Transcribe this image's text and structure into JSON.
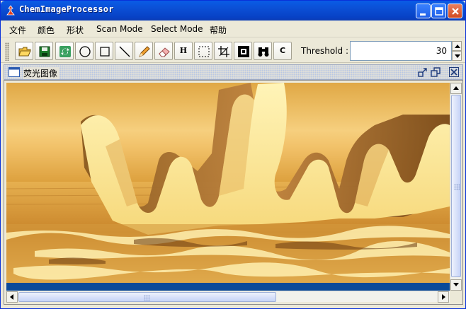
{
  "window": {
    "title": "ChemImageProcessor",
    "buttons": [
      "minimize",
      "maximize",
      "close"
    ]
  },
  "menu": {
    "items": [
      "文件",
      "颜色",
      "形状",
      "Scan Mode",
      "Select Mode",
      "帮助"
    ]
  },
  "toolbar": {
    "tools": [
      {
        "name": "open-icon"
      },
      {
        "name": "save-icon"
      },
      {
        "name": "refresh-icon"
      },
      {
        "name": "circle-icon"
      },
      {
        "name": "rectangle-icon"
      },
      {
        "name": "line-icon"
      },
      {
        "name": "pencil-icon"
      },
      {
        "name": "eraser-icon"
      },
      {
        "name": "h-tool",
        "label": "H"
      },
      {
        "name": "select-rect-icon"
      },
      {
        "name": "crop-icon"
      },
      {
        "name": "frame-icon"
      },
      {
        "name": "binoculars-icon"
      },
      {
        "name": "c-tool",
        "label": "C"
      }
    ],
    "threshold_label": "Threshold :",
    "threshold_value": "30"
  },
  "internal_frame": {
    "title": "荧光图像"
  },
  "scroll": {
    "vertical_position": 0.0,
    "horizontal_position": 0.0
  },
  "colors": {
    "title_bar": "#0b4fd5",
    "window_bg": "#ece9d8",
    "image_gold": "#f5c060"
  }
}
